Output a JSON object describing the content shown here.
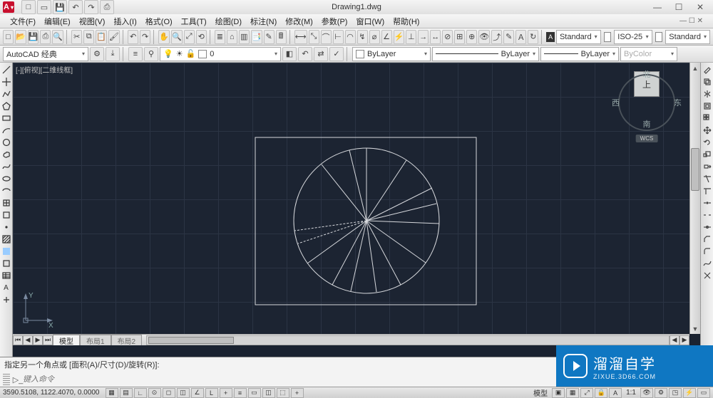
{
  "title": "Drawing1.dwg",
  "app_logo": "A",
  "searchbox": {
    "placeholder": ""
  },
  "window_buttons": {
    "min": "—",
    "max": "☐",
    "close": "✕"
  },
  "menu": [
    "文件(F)",
    "编辑(E)",
    "视图(V)",
    "插入(I)",
    "格式(O)",
    "工具(T)",
    "绘图(D)",
    "标注(N)",
    "修改(M)",
    "参数(P)",
    "窗口(W)",
    "帮助(H)"
  ],
  "toolbar1_icons": [
    "new",
    "open",
    "save",
    "saveas",
    "plot",
    "preview",
    "publish",
    "cut",
    "copy",
    "paste",
    "matchprop",
    "undo",
    "redo",
    "pan",
    "zoomext",
    "zoomwin",
    "zoomprev",
    "props",
    "designctr",
    "toolpal",
    "calc",
    "help"
  ],
  "row1_style": {
    "label_text": "Standard",
    "label_dim": "ISO-25",
    "label_table": "Standard"
  },
  "workspace_combo": "AutoCAD 经典",
  "layer_combo": "0",
  "layer_color": "#ffffff",
  "props": {
    "color_label": "ByLayer",
    "ltype": "ByLayer",
    "lweight": "ByLayer",
    "plotstyle": "ByColor"
  },
  "viewport_label": "[-][俯视][二维线框]",
  "viewcube": {
    "n": "北",
    "s": "南",
    "e": "东",
    "w": "西",
    "top": "上",
    "wcs": "WCS"
  },
  "ucs": {
    "x": "X",
    "y": "Y"
  },
  "tabs": {
    "model": "模型",
    "layout1": "布局1",
    "layout2": "布局2"
  },
  "cmd_history": "指定另一个角点或 [面积(A)/尺寸(D)/旋转(R)]:",
  "cmd_placeholder": "键入命令",
  "status": {
    "coords": "3590.5108, 1122.4070, 0.0000",
    "model": "模型",
    "scale": "1:1"
  },
  "status_icons": [
    "snap",
    "grid",
    "ortho",
    "polar",
    "osnap",
    "3dosnap",
    "otrack",
    "ducs",
    "dyn",
    "lwt",
    "tpy",
    "qprops",
    "sel",
    "annoscale",
    "vis"
  ],
  "watermark": {
    "text1": "溜溜自学",
    "text2": "ZIXUE.3D66.COM"
  },
  "left_tools": [
    "line",
    "construction",
    "polyline",
    "polygon",
    "rect",
    "arc",
    "circle",
    "revcloud",
    "spline",
    "ellipse",
    "ellipse-arc",
    "insert",
    "block",
    "point",
    "hatch",
    "gradient",
    "region",
    "table",
    "mtext",
    "addpoint"
  ],
  "right_tools": [
    "erase",
    "copy",
    "mirror",
    "offset",
    "array",
    "move",
    "rotate",
    "scale",
    "stretch",
    "trim",
    "extend",
    "break",
    "breakpoint",
    "join",
    "chamfer",
    "fillet",
    "blend",
    "explode"
  ]
}
